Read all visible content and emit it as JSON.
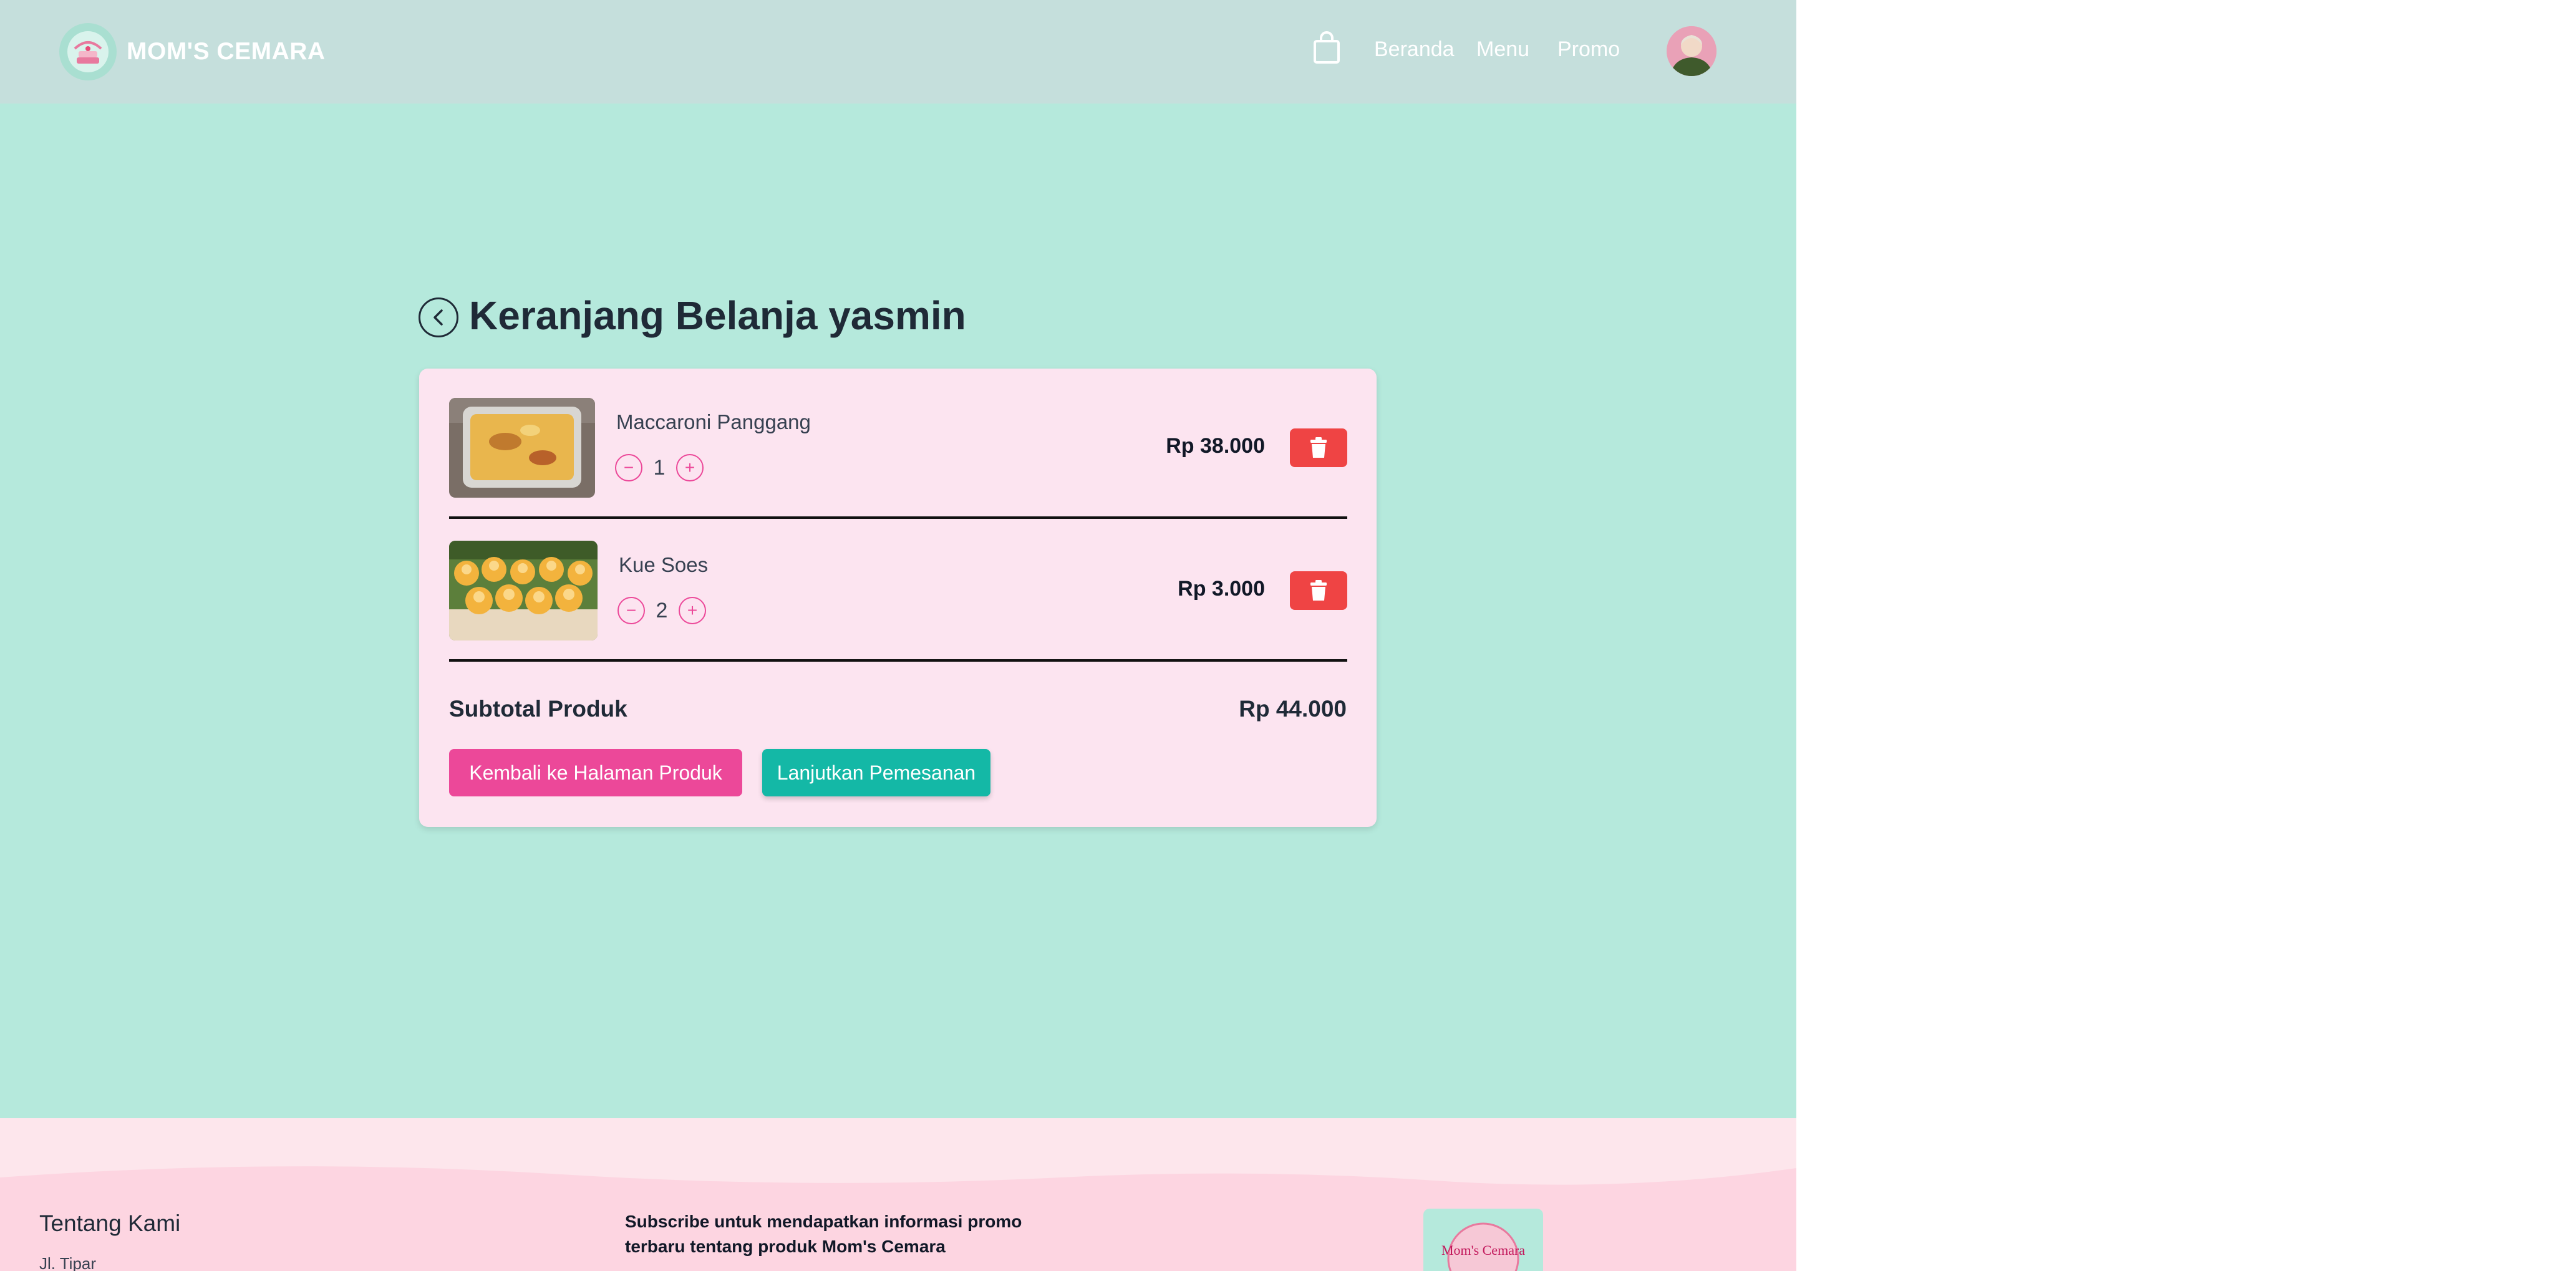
{
  "header": {
    "brand": "MOM'S CEMARA",
    "nav": [
      "Beranda",
      "Menu",
      "Promo"
    ]
  },
  "cart": {
    "title": "Keranjang Belanja yasmin",
    "items": [
      {
        "name": "Maccaroni Panggang",
        "qty": "1",
        "price": "Rp 38.000"
      },
      {
        "name": "Kue Soes",
        "qty": "2",
        "price": "Rp 3.000"
      }
    ],
    "subtotal_label": "Subtotal Produk",
    "subtotal_value": "Rp 44.000",
    "back_button": "Kembali ke Halaman Produk",
    "continue_button": "Lanjutkan Pemesanan"
  },
  "footer": {
    "about_title": "Tentang Kami",
    "address": "Jl. Tipar",
    "subscribe": "Subscribe untuk mendapatkan informasi promo terbaru tentang produk Mom's Cemara",
    "logo_text": "Mom's Cemara"
  },
  "icons": {
    "cart": "shopping-bag-icon",
    "back": "chevron-left-icon",
    "delete": "trash-icon",
    "minus": "minus-icon",
    "plus": "plus-icon"
  },
  "colors": {
    "page_bg": "#b5e9dc",
    "header_bg": "#c5dfdc",
    "card_bg": "#fce4f0",
    "pink_accent": "#ec4899",
    "teal_accent": "#14b8a6",
    "delete_red": "#ef4444",
    "footer_bg": "#fdd5e1"
  }
}
